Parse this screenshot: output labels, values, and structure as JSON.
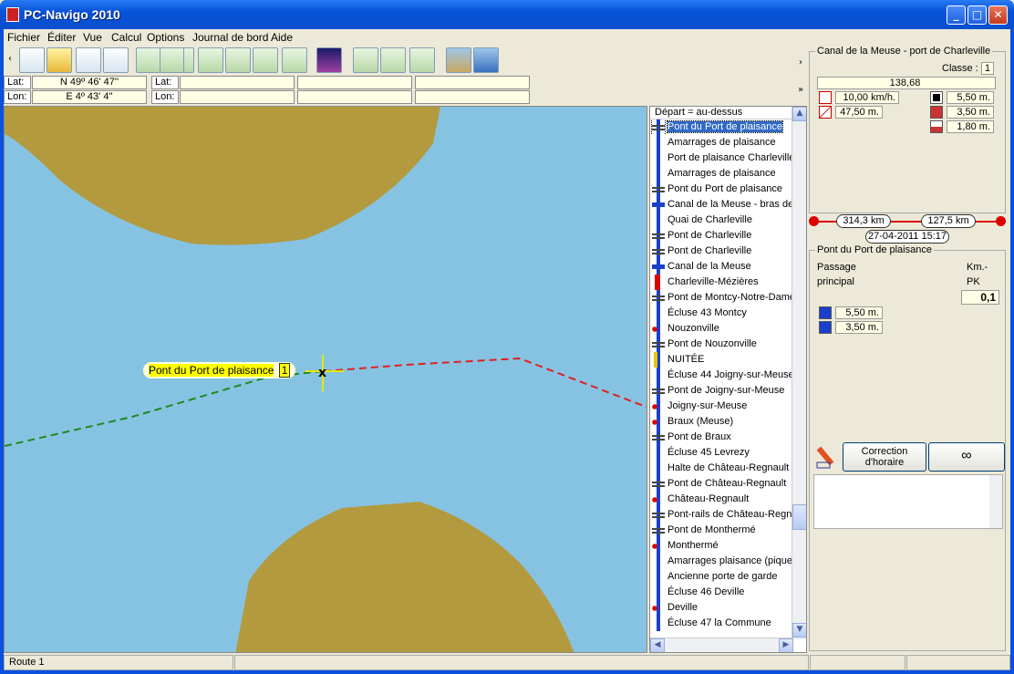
{
  "window": {
    "title": "PC-Navigo 2010"
  },
  "menu": [
    "Fichier",
    "Éditer",
    "Vue",
    "Calcul",
    "Options",
    "Journal de bord",
    "Aide"
  ],
  "coords": {
    "lat_label": "Lat:",
    "lon_label": "Lon:",
    "lat1": "N 49º 46' 47''",
    "lon1": "E 4º 43' 4''",
    "lat2": "",
    "lon2": ""
  },
  "map": {
    "route_label": "Pont du Port de plaisance",
    "route_badge": "1",
    "colors": {
      "water": "#86c3e3",
      "land": "#b39a3e",
      "route_past": "#1f8a1f",
      "route_next": "#e02020"
    }
  },
  "list": {
    "header": "Départ = au-dessus",
    "items": [
      {
        "label": "Pont du Port de plaisance",
        "icon": "bridge-icon",
        "selected": true
      },
      {
        "label": "Amarrages de plaisance",
        "icon": "mooring-icon"
      },
      {
        "label": "Port de plaisance Charleville",
        "icon": "port-icon"
      },
      {
        "label": "Amarrages de plaisance",
        "icon": "mooring-icon"
      },
      {
        "label": "Pont du Port de plaisance",
        "icon": "bridge-icon"
      },
      {
        "label": "Canal de la Meuse - bras de M",
        "icon": "junction-icon"
      },
      {
        "label": "Quai de Charleville",
        "icon": "quay-icon"
      },
      {
        "label": "Pont de Charleville",
        "icon": "bridge-icon"
      },
      {
        "label": "Pont de Charleville",
        "icon": "bridge-icon"
      },
      {
        "label": "Canal de la Meuse",
        "icon": "junction-icon"
      },
      {
        "label": "Charleville-Mézières",
        "icon": "town-icon"
      },
      {
        "label": "Pont de Montcy-Notre-Dame",
        "icon": "bridge-icon"
      },
      {
        "label": "Écluse 43 Montcy",
        "icon": "lock-icon"
      },
      {
        "label": "Nouzonville",
        "icon": "village-icon"
      },
      {
        "label": "Pont de Nouzonville",
        "icon": "bridge-icon"
      },
      {
        "label": "NUITÉE",
        "icon": "night-icon"
      },
      {
        "label": "Écluse 44 Joigny-sur-Meuse",
        "icon": "lock-icon"
      },
      {
        "label": "Pont de Joigny-sur-Meuse",
        "icon": "bridge-icon"
      },
      {
        "label": "Joigny-sur-Meuse",
        "icon": "village-icon"
      },
      {
        "label": "Braux (Meuse)",
        "icon": "village-icon"
      },
      {
        "label": "Pont de Braux",
        "icon": "bridge-icon"
      },
      {
        "label": "Écluse 45 Levrezy",
        "icon": "lock-icon"
      },
      {
        "label": "Halte de Château-Regnault",
        "icon": "quay-icon"
      },
      {
        "label": "Pont de Château-Regnault",
        "icon": "bridge-icon"
      },
      {
        "label": "Château-Regnault",
        "icon": "village-icon"
      },
      {
        "label": "Pont-rails de Château-Regnau",
        "icon": "bridge-icon"
      },
      {
        "label": "Pont de Monthermé",
        "icon": "bridge-icon"
      },
      {
        "label": "Monthermé",
        "icon": "village-icon"
      },
      {
        "label": "Amarrages plaisance (pique-n",
        "icon": "mooring-icon"
      },
      {
        "label": "Ancienne porte de garde",
        "icon": "gate-icon"
      },
      {
        "label": "Écluse 46 Deville",
        "icon": "lock-icon"
      },
      {
        "label": "Deville",
        "icon": "village-icon"
      },
      {
        "label": "Écluse 47 la Commune",
        "icon": "lock-icon"
      }
    ]
  },
  "info": {
    "waterway": "Canal de la Meuse - port de Charleville",
    "class_label": "Classe :",
    "class_value": "1",
    "total": "138,68",
    "speed": "10,00 km/h.",
    "length_val": "47,50 m.",
    "h1": "5,50 m.",
    "h2": "3,50 m.",
    "h3": "1,80 m."
  },
  "progress": {
    "left": "314,3 km",
    "right": "127,5 km",
    "datetime": "27-04-2011 15:17",
    "fraction": 0.71
  },
  "point": {
    "title": "Pont du Port de plaisance",
    "type1": "Passage",
    "type2": "principal",
    "km_label": "Km.-",
    "pk_label": "PK",
    "pk_value": "0,1",
    "clear1": "5,50 m.",
    "clear2": "3,50 m."
  },
  "buttons": {
    "correction": "Correction\nd'horaire",
    "correction_l1": "Correction",
    "correction_l2": "d'horaire"
  },
  "status": {
    "route": "Route 1"
  }
}
